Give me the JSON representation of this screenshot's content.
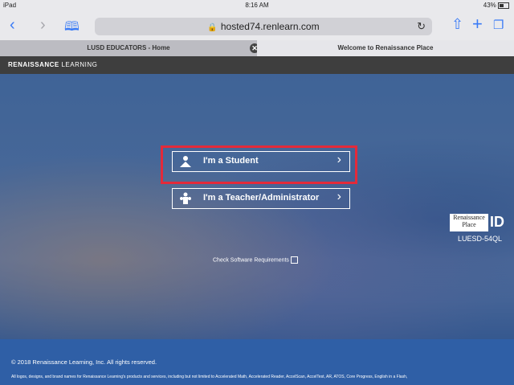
{
  "status": {
    "device": "iPad",
    "time": "8:16 AM",
    "battery": "43%"
  },
  "toolbar": {
    "url": "hosted74.renlearn.com"
  },
  "tabs": [
    {
      "label": "LUSD EDUCATORS - Home"
    },
    {
      "label": "Welcome to Renaissance Place"
    }
  ],
  "brand": {
    "bold": "RENAISSANCE",
    "light": " LEARNING"
  },
  "login": {
    "student_label": "I'm a Student",
    "teacher_label": "I'm a Teacher/Administrator",
    "check_label": "Check Software Requirements"
  },
  "rp": {
    "logo_top": "Renaissance",
    "logo_bottom": "Place",
    "id": "ID",
    "code": "LUESD-54QL"
  },
  "footer": {
    "copyright": "© 2018 Renaissance Learning, Inc. All rights reserved.",
    "legal": "All logos, designs, and brand names for Renaissance Learning's products and services, including but not limited to Accelerated Math, Accelerated Reader, AccelScan, AccelTest, AR, ATOS, Core Progress, English in a Flash,"
  },
  "colors": {
    "highlight": "#e32a3a",
    "accent": "#3a7bf6",
    "footer": "#2f5fa6"
  }
}
